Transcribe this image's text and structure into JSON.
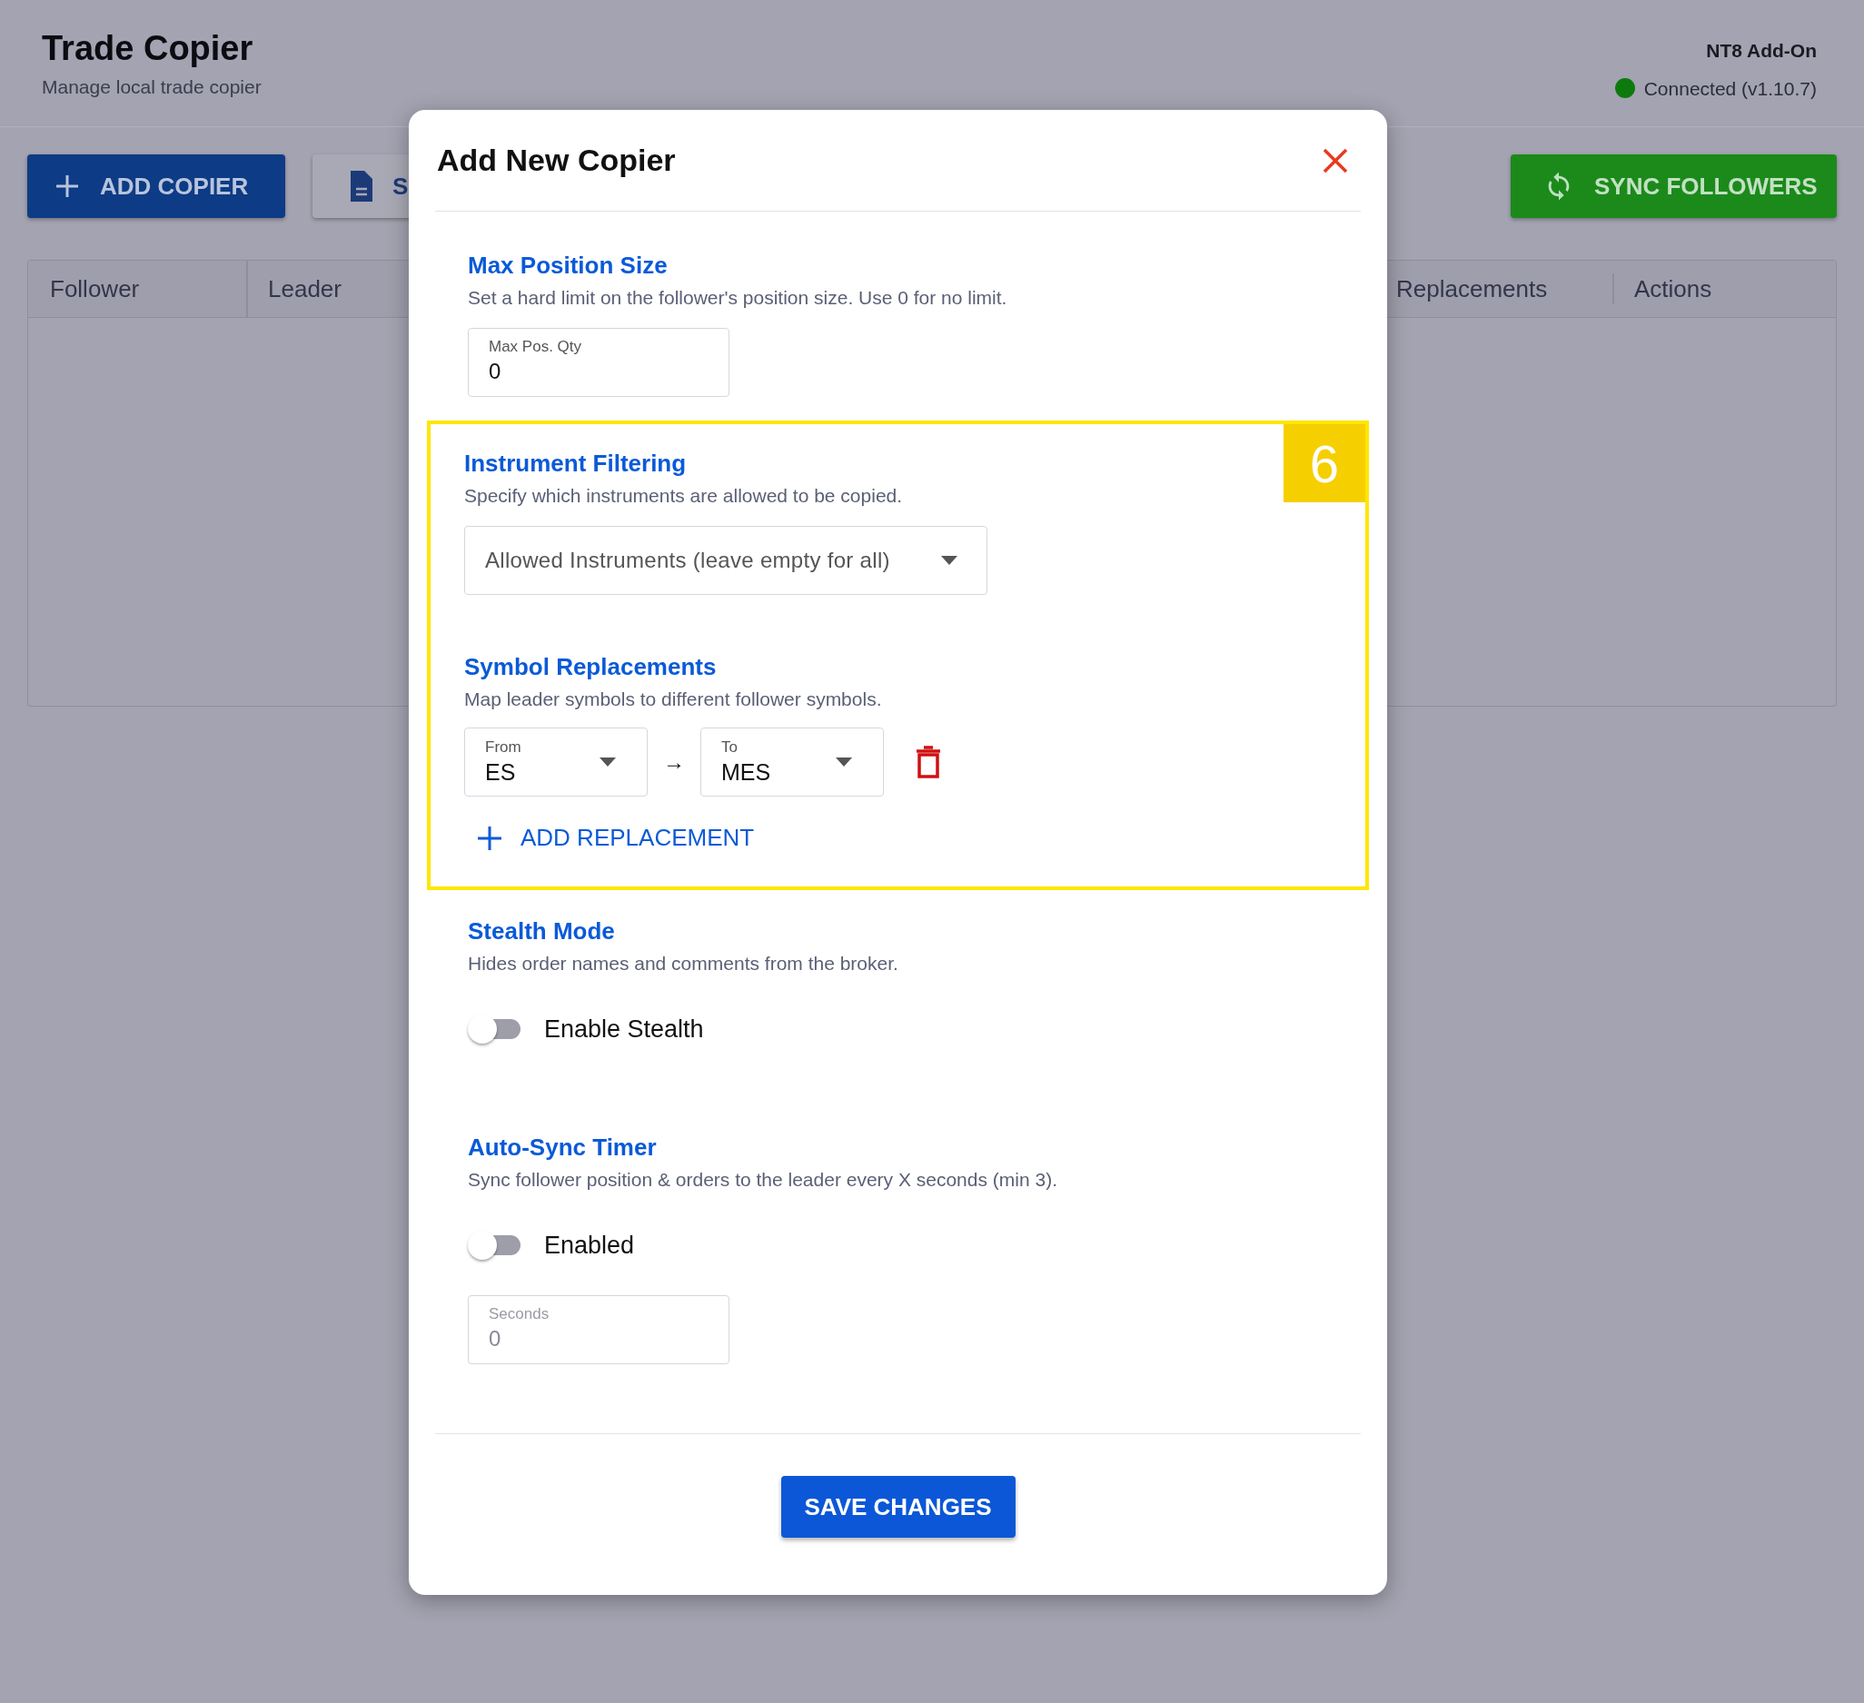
{
  "header": {
    "title": "Trade Copier",
    "subtitle": "Manage local trade copier",
    "addon": "NT8 Add-On",
    "status": "Connected (v1.10.7)",
    "connected": true
  },
  "toolbar": [
    {
      "kind": "add",
      "label": "ADD COPIER"
    },
    {
      "kind": "document",
      "label": "S"
    },
    {
      "kind": "sync",
      "label": "SYNC FOLLOWERS"
    }
  ],
  "table": {
    "columns": [
      "Follower",
      "Leader",
      "Replacements",
      "Actions"
    ]
  },
  "modal": {
    "title": "Add New Copier",
    "groups": [
      {
        "highlighted": false,
        "sections": [
          {
            "kind": "number",
            "title": "Max Position Size",
            "description": "Set a hard limit on the follower's position size. Use 0 for no limit.",
            "field": {
              "label": "Max Pos. Qty",
              "value": "0",
              "disabled": false
            }
          }
        ]
      },
      {
        "highlighted": true,
        "badge": "6",
        "sections": [
          {
            "kind": "select",
            "title": "Instrument Filtering",
            "description": "Specify which instruments are allowed to be copied.",
            "placeholder": "Allowed Instruments (leave empty for all)"
          },
          {
            "kind": "replacements",
            "title": "Symbol Replacements",
            "description": "Map leader symbols to different follower symbols.",
            "rows": [
              {
                "from": {
                  "label": "From",
                  "value": "ES"
                },
                "arrow": "→",
                "to": {
                  "label": "To",
                  "value": "MES"
                }
              }
            ],
            "add_label": "ADD REPLACEMENT"
          }
        ]
      },
      {
        "highlighted": false,
        "sections": [
          {
            "kind": "toggle",
            "title": "Stealth Mode",
            "description": "Hides order names and comments from the broker.",
            "toggle": {
              "label": "Enable Stealth",
              "on": false
            }
          },
          {
            "kind": "toggle",
            "title": "Auto-Sync Timer",
            "description": "Sync follower position & orders to the leader every X seconds (min 3).",
            "toggle": {
              "label": "Enabled",
              "on": false
            },
            "field": {
              "label": "Seconds",
              "value": "0",
              "disabled": true
            }
          }
        ]
      }
    ],
    "save_label": "SAVE CHANGES"
  }
}
